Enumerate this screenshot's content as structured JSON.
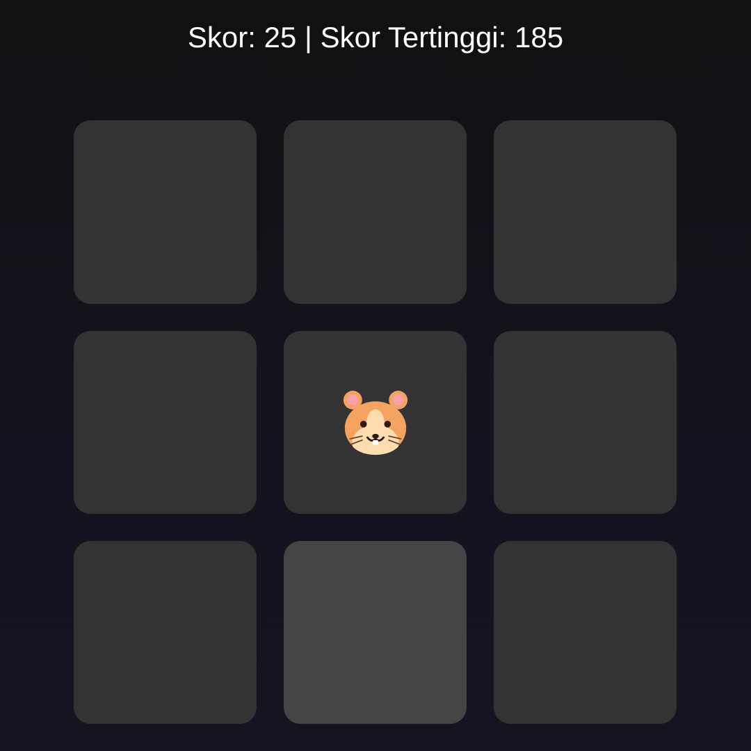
{
  "score": {
    "label": "Skor:",
    "value": "25",
    "separator": "|",
    "high_label": "Skor Tertinggi:",
    "high_value": "185"
  },
  "board": {
    "rows": 3,
    "columns": 3,
    "hamster_cell": 4,
    "highlighted_cell": 7,
    "cells": [
      {
        "index": 0,
        "occupant": null
      },
      {
        "index": 1,
        "occupant": null
      },
      {
        "index": 2,
        "occupant": null
      },
      {
        "index": 3,
        "occupant": null
      },
      {
        "index": 4,
        "occupant": "hamster-icon"
      },
      {
        "index": 5,
        "occupant": null
      },
      {
        "index": 6,
        "occupant": null
      },
      {
        "index": 7,
        "occupant": null
      },
      {
        "index": 8,
        "occupant": null
      }
    ]
  },
  "colors": {
    "background": "#111113",
    "hole": "#333333",
    "hole_highlight": "#454545",
    "text": "#ffffff"
  }
}
